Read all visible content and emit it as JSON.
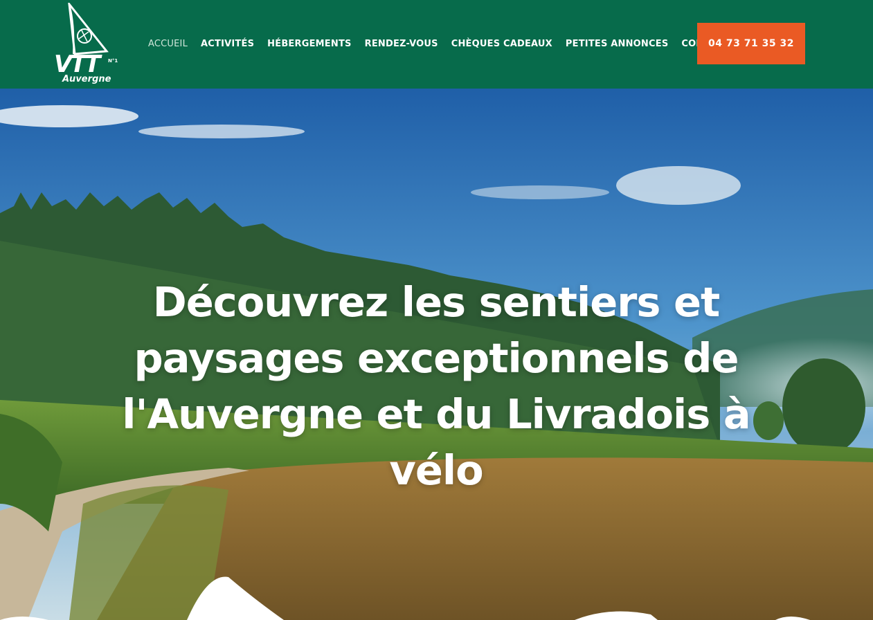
{
  "header": {
    "logo": {
      "text": "VTT",
      "sub": "Auvergne",
      "badge": "N°1"
    },
    "nav": [
      {
        "label": "Accueil",
        "active": true
      },
      {
        "label": "Activités",
        "active": false
      },
      {
        "label": "Hébergements",
        "active": false
      },
      {
        "label": "Rendez-vous",
        "active": false
      },
      {
        "label": "Chèques cadeaux",
        "active": false
      },
      {
        "label": "Petites annonces",
        "active": false
      },
      {
        "label": "Contact",
        "active": false
      }
    ],
    "phone": "04 73 71 35 32"
  },
  "hero": {
    "title": "Découvrez les sentiers et paysages exceptionnels de l'Auvergne et du Livradois à vélo"
  },
  "colors": {
    "header_bg": "#076b4b",
    "phone_bg": "#ea5a24",
    "text": "#ffffff"
  }
}
